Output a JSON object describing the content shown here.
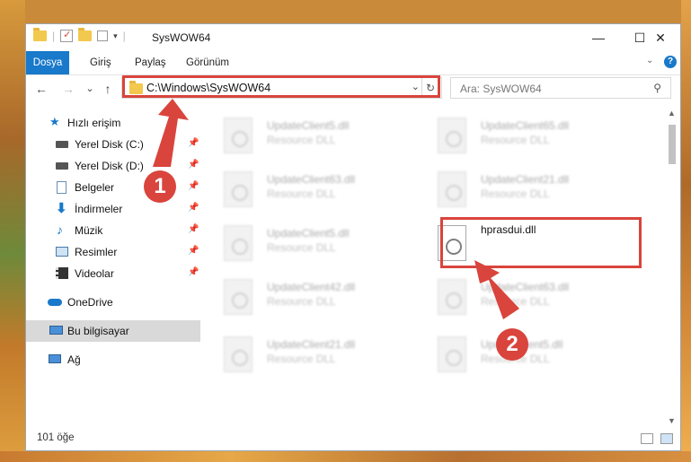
{
  "window": {
    "title": "SysWOW64",
    "minimize_glyph": "—",
    "maximize_glyph": "☐",
    "close_glyph": "✕"
  },
  "ribbon": {
    "tabs": [
      "Dosya",
      "Giriş",
      "Paylaş",
      "Görünüm"
    ],
    "active_tab": "Dosya",
    "help_glyph": "?"
  },
  "nav": {
    "back_glyph": "←",
    "forward_glyph": "→",
    "recent_glyph": "⌄",
    "up_glyph": "↑",
    "address": "C:\\Windows\\SysWOW64",
    "refresh_glyph": "↻",
    "search_placeholder": "Ara: SysWOW64"
  },
  "sidebar": {
    "items": [
      {
        "label": "Hızlı erişim",
        "icon": "star-icon"
      },
      {
        "label": "Yerel Disk (C:)",
        "icon": "drive-icon",
        "pinned": true
      },
      {
        "label": "Yerel Disk (D:)",
        "icon": "drive-icon",
        "pinned": true
      },
      {
        "label": "Belgeler",
        "icon": "documents-icon",
        "pinned": true
      },
      {
        "label": "İndirmeler",
        "icon": "download-icon",
        "pinned": true
      },
      {
        "label": "Müzik",
        "icon": "music-icon",
        "pinned": true
      },
      {
        "label": "Resimler",
        "icon": "pictures-icon",
        "pinned": true
      },
      {
        "label": "Videolar",
        "icon": "videos-icon",
        "pinned": true
      },
      {
        "label": "OneDrive",
        "icon": "cloud-icon"
      },
      {
        "label": "Bu bilgisayar",
        "icon": "computer-icon",
        "selected": true
      },
      {
        "label": "Ağ",
        "icon": "network-icon"
      }
    ],
    "pin_glyph": "📌"
  },
  "files": [
    {
      "name": "UpdateClient5.dll",
      "desc": "Resource DLL"
    },
    {
      "name": "UpdateClient65.dll",
      "desc": "Resource DLL"
    },
    {
      "name": "UpdateClient63.dll",
      "desc": "Resource DLL"
    },
    {
      "name": "UpdateClient21.dll",
      "desc": "Resource DLL"
    },
    {
      "name": "UpdateClient5.dll",
      "desc": "Resource DLL"
    },
    {
      "name": "hprasdui.dll",
      "desc": ""
    },
    {
      "name": "UpdateClient42.dll",
      "desc": "Resource DLL"
    },
    {
      "name": "UpdateClient63.dll",
      "desc": "Resource DLL"
    },
    {
      "name": "UpdateClient21.dll",
      "desc": "Resource DLL"
    },
    {
      "name": "UpdateClient5.dll",
      "desc": "Resource DLL"
    }
  ],
  "status": {
    "item_count": "101 öğe"
  },
  "annotations": {
    "marker1": "1",
    "marker2": "2",
    "color": "#d9443c"
  },
  "colors": {
    "accent": "#1979ca",
    "highlight": "#d9443c",
    "selected_bg": "#d9d9d9"
  }
}
